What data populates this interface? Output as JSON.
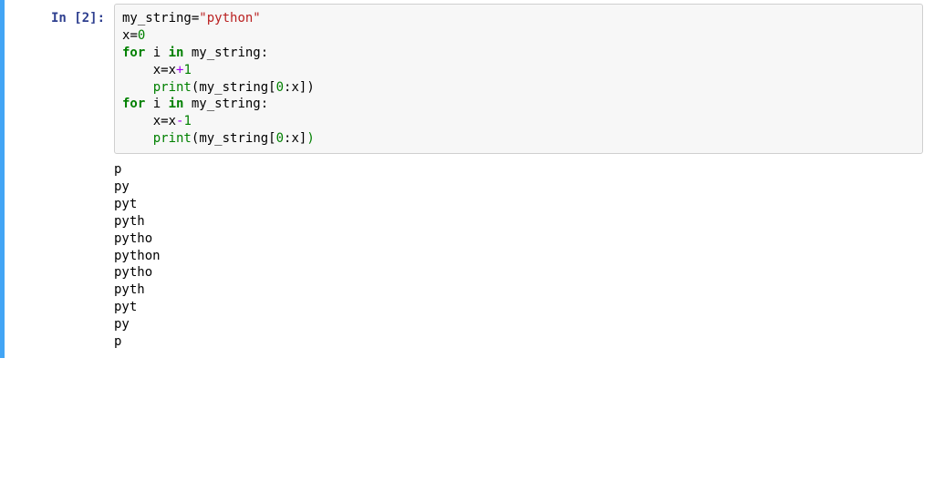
{
  "cell": {
    "prompt_label": "In ",
    "exec_count": "2",
    "prompt_open": "[",
    "prompt_close": "]:",
    "code_lines": [
      [
        {
          "cls": "tok-name",
          "t": "my_string"
        },
        {
          "cls": "tok-op",
          "t": "="
        },
        {
          "cls": "tok-str",
          "t": "\"python\""
        }
      ],
      [
        {
          "cls": "tok-name",
          "t": "x"
        },
        {
          "cls": "tok-op",
          "t": "="
        },
        {
          "cls": "tok-num",
          "t": "0"
        }
      ],
      [
        {
          "cls": "tok-kw",
          "t": "for"
        },
        {
          "cls": "tok-name",
          "t": " i "
        },
        {
          "cls": "tok-kw",
          "t": "in"
        },
        {
          "cls": "tok-name",
          "t": " my_string"
        },
        {
          "cls": "tok-punct",
          "t": ":"
        }
      ],
      [
        {
          "cls": "tok-name",
          "t": "    x"
        },
        {
          "cls": "tok-op",
          "t": "="
        },
        {
          "cls": "tok-name",
          "t": "x"
        },
        {
          "cls": "tok-op-purple",
          "t": "+"
        },
        {
          "cls": "tok-num",
          "t": "1"
        }
      ],
      [
        {
          "cls": "tok-name",
          "t": "    "
        },
        {
          "cls": "tok-builtin",
          "t": "print"
        },
        {
          "cls": "tok-punct",
          "t": "("
        },
        {
          "cls": "tok-name",
          "t": "my_string"
        },
        {
          "cls": "tok-punct",
          "t": "["
        },
        {
          "cls": "tok-num",
          "t": "0"
        },
        {
          "cls": "tok-punct",
          "t": ":"
        },
        {
          "cls": "tok-name",
          "t": "x"
        },
        {
          "cls": "tok-punct",
          "t": "])"
        }
      ],
      [
        {
          "cls": "tok-kw",
          "t": "for"
        },
        {
          "cls": "tok-name",
          "t": " i "
        },
        {
          "cls": "tok-kw",
          "t": "in"
        },
        {
          "cls": "tok-name",
          "t": " my_string"
        },
        {
          "cls": "tok-punct",
          "t": ":"
        }
      ],
      [
        {
          "cls": "tok-name",
          "t": "    x"
        },
        {
          "cls": "tok-op",
          "t": "="
        },
        {
          "cls": "tok-name",
          "t": "x"
        },
        {
          "cls": "tok-op-purple",
          "t": "-"
        },
        {
          "cls": "tok-num",
          "t": "1"
        }
      ],
      [
        {
          "cls": "tok-name",
          "t": "    "
        },
        {
          "cls": "tok-builtin",
          "t": "print"
        },
        {
          "cls": "tok-punct",
          "t": "("
        },
        {
          "cls": "tok-name",
          "t": "my_string"
        },
        {
          "cls": "tok-punct",
          "t": "["
        },
        {
          "cls": "tok-num",
          "t": "0"
        },
        {
          "cls": "tok-punct",
          "t": ":"
        },
        {
          "cls": "tok-name",
          "t": "x"
        },
        {
          "cls": "tok-punct",
          "t": "]"
        },
        {
          "cls": "tok-punct-green",
          "t": ")"
        }
      ]
    ],
    "output_lines": [
      "p",
      "py",
      "pyt",
      "pyth",
      "pytho",
      "python",
      "pytho",
      "pyth",
      "pyt",
      "py",
      "p"
    ]
  }
}
